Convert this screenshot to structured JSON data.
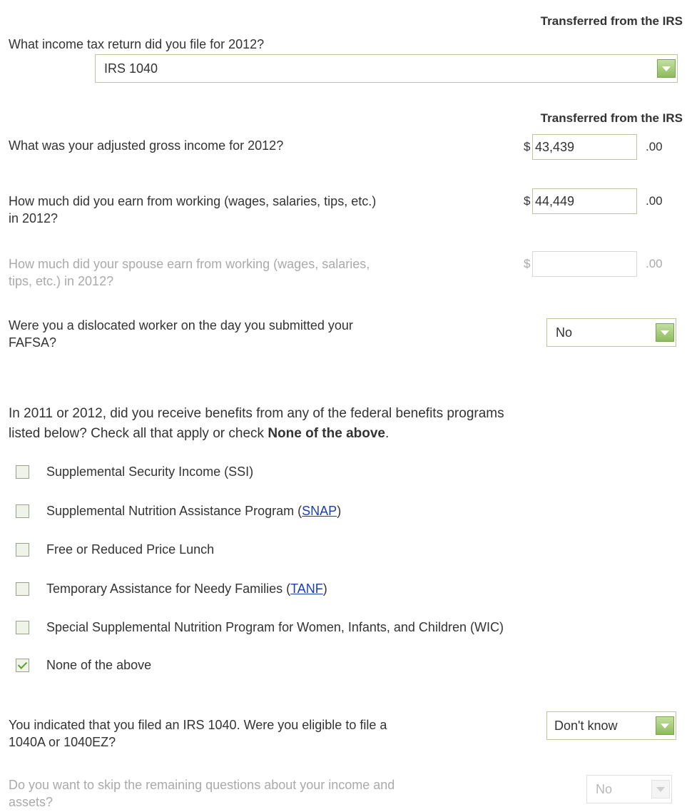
{
  "irs_label": "Transferred from the IRS",
  "tax_return": {
    "question": "What income tax return did you file for 2012?",
    "selected": "IRS 1040"
  },
  "agi": {
    "question": "What was your adjusted gross income for 2012?",
    "currency": "$",
    "value": "43,439",
    "cents": ".00"
  },
  "earned": {
    "question_line1": "How much did you earn from working (wages, salaries, tips, etc.)",
    "question_line2": "in 2012?",
    "currency": "$",
    "value": "44,449",
    "cents": ".00"
  },
  "spouse_earned": {
    "question_line1": "How much did your spouse earn from working (wages, salaries,",
    "question_line2": "tips, etc.) in 2012?",
    "currency": "$",
    "value": "",
    "cents": ".00"
  },
  "dislocated": {
    "question_line1": "Were you a dislocated worker on the day you submitted your",
    "question_line2": "FAFSA?",
    "selected": "No"
  },
  "benefits": {
    "intro_line1": "In 2011 or 2012, did you receive benefits from any of the federal benefits programs",
    "intro_line2_prefix": "listed below? Check all that apply or check ",
    "intro_line2_bold": "None of the above",
    "intro_line2_suffix": ".",
    "items": [
      {
        "label": "Supplemental Security Income (SSI)",
        "link": "",
        "suffix": "",
        "checked": false
      },
      {
        "label": "Supplemental Nutrition Assistance Program (",
        "link": "SNAP",
        "suffix": ")",
        "checked": false
      },
      {
        "label": "Free or Reduced Price Lunch",
        "link": "",
        "suffix": "",
        "checked": false
      },
      {
        "label": "Temporary Assistance for Needy Families (",
        "link": "TANF",
        "suffix": ")",
        "checked": false
      },
      {
        "label": "Special Supplemental Nutrition Program for Women, Infants, and Children (WIC)",
        "link": "",
        "suffix": "",
        "checked": false
      },
      {
        "label": "None of the above",
        "link": "",
        "suffix": "",
        "checked": true
      }
    ]
  },
  "eligible_1040a": {
    "question_line1": "You indicated that you filed an IRS 1040. Were you eligible to file a",
    "question_line2": "1040A or 1040EZ?",
    "selected": "Don't know"
  },
  "skip_remaining": {
    "question_line1": "Do you want to skip the remaining questions about your income and",
    "question_line2": "assets?",
    "selected": "No"
  },
  "colors": {
    "select_border": "#bcc7a0",
    "arrow_green": "#8dbb5e",
    "link_blue": "#1a3fb5",
    "muted_text": "#aaaaaa",
    "check_green": "#5ba02a"
  }
}
